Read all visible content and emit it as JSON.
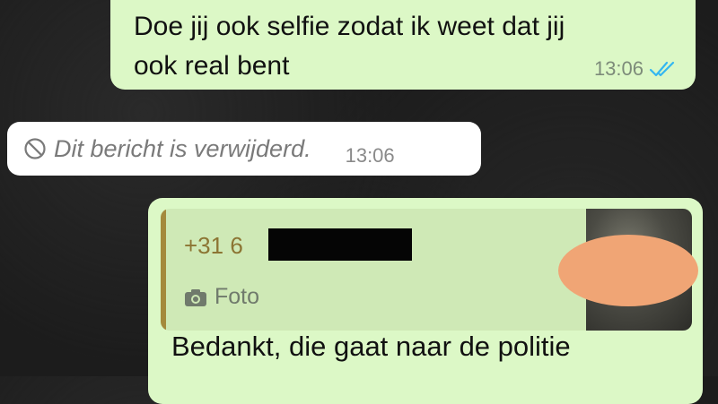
{
  "messages": {
    "outgoing_top": {
      "text": "Doe jij ook selfie zodat ik weet dat jij ook real bent",
      "time": "13:06",
      "status_icon": "double-check-read-icon",
      "status_color": "#34b7f1"
    },
    "deleted_incoming": {
      "text": "Dit bericht is verwijderd.",
      "time": "13:06",
      "icon": "blocked-icon"
    },
    "outgoing_reply": {
      "quoted": {
        "sender": "+31 6",
        "media_label": "Foto",
        "media_icon": "camera-icon"
      },
      "text": "Bedankt, die gaat naar de politie"
    }
  },
  "colors": {
    "outgoing_bubble": "#dcf8c6",
    "incoming_bubble": "#ffffff",
    "quote_accent": "#a48a3c",
    "background": "#1c1c1c"
  }
}
